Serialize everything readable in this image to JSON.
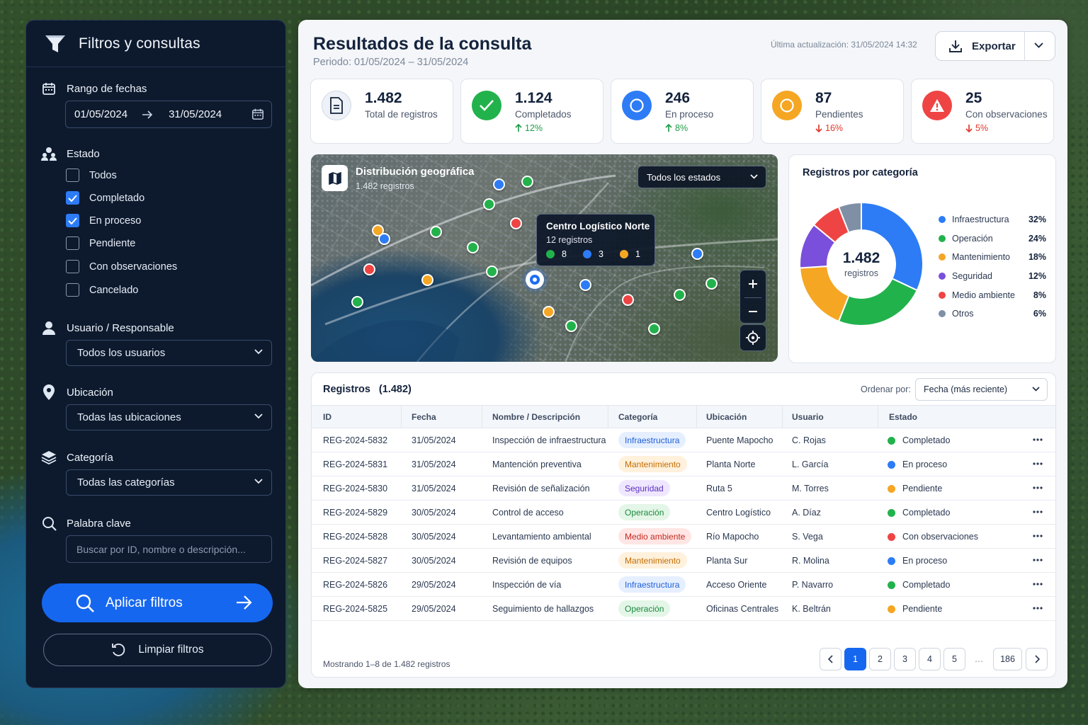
{
  "sidebar": {
    "title": "Filtros y consultas",
    "date_range": {
      "label": "Rango de fechas",
      "from": "01/05/2024",
      "to": "31/05/2024"
    },
    "status": {
      "label": "Estado",
      "options": [
        {
          "label": "Todos",
          "checked": false
        },
        {
          "label": "Completado",
          "checked": true
        },
        {
          "label": "En proceso",
          "checked": true
        },
        {
          "label": "Pendiente",
          "checked": false
        },
        {
          "label": "Con observaciones",
          "checked": false
        },
        {
          "label": "Cancelado",
          "checked": false
        }
      ]
    },
    "user": {
      "label": "Usuario / Responsable",
      "value": "Todos los usuarios"
    },
    "location": {
      "label": "Ubicación",
      "value": "Todas las ubicaciones"
    },
    "category": {
      "label": "Categoría",
      "value": "Todas las categorías"
    },
    "keyword": {
      "label": "Palabra clave",
      "placeholder": "Buscar por ID, nombre o descripción..."
    },
    "apply_label": "Aplicar filtros",
    "clear_label": "Limpiar filtros"
  },
  "header": {
    "title": "Resultados de la consulta",
    "period": "Periodo: 01/05/2024 – 31/05/2024",
    "updated": "Última actualización: 31/05/2024 14:32",
    "export_label": "Exportar"
  },
  "kpis": [
    {
      "value": "1.482",
      "label": "Total de registros",
      "delta": "",
      "dir": "",
      "icon": "document-icon"
    },
    {
      "value": "1.124",
      "label": "Completados",
      "delta": "12%",
      "dir": "up",
      "icon": "check-icon"
    },
    {
      "value": "246",
      "label": "En proceso",
      "delta": "8%",
      "dir": "up",
      "icon": "circle-icon"
    },
    {
      "value": "87",
      "label": "Pendientes",
      "delta": "16%",
      "dir": "down",
      "icon": "circle-icon"
    },
    {
      "value": "25",
      "label": "Con observaciones",
      "delta": "5%",
      "dir": "down",
      "icon": "warning-icon"
    }
  ],
  "map": {
    "title": "Distribución geográfica",
    "subtitle": "1.482 registros",
    "filter": "Todos los estados",
    "tooltip": {
      "title": "Centro Logístico Norte",
      "subtitle": "12 registros",
      "counts": [
        {
          "color": "#22b24c",
          "value": "8"
        },
        {
          "color": "#2d7cf6",
          "value": "3"
        },
        {
          "color": "#f5a623",
          "value": "1"
        }
      ]
    }
  },
  "colors": {
    "blue": "#2d7cf6",
    "green": "#22b24c",
    "orange": "#f5a623",
    "purple": "#7a4fdc",
    "red": "#ef4444",
    "gray": "#7f8fa6",
    "primary": "#1667f0"
  },
  "categories_card": {
    "title": "Registros por categoría",
    "center_value": "1.482",
    "center_label": "registros"
  },
  "chart_data": {
    "type": "pie",
    "title": "Registros por categoría",
    "categories": [
      "Infraestructura",
      "Operación",
      "Mantenimiento",
      "Seguridad",
      "Medio ambiente",
      "Otros"
    ],
    "values": [
      32,
      24,
      18,
      12,
      8,
      6
    ],
    "labels": [
      "32%",
      "24%",
      "18%",
      "12%",
      "8%",
      "6%"
    ],
    "colors": [
      "#2d7cf6",
      "#22b24c",
      "#f5a623",
      "#7a4fdc",
      "#ef4444",
      "#7f8fa6"
    ],
    "legend": "right"
  },
  "table": {
    "title": "Registros",
    "count": "(1.482)",
    "sort_label": "Ordenar por:",
    "sort_value": "Fecha (más reciente)",
    "columns": [
      "ID",
      "Fecha",
      "Nombre / Descripción",
      "Categoría",
      "Ubicación",
      "Usuario",
      "Estado"
    ],
    "rows": [
      {
        "id": "REG-2024-5832",
        "date": "31/05/2024",
        "name": "Inspección de infraestructura",
        "cat": "Infraestructura",
        "loc": "Puente Mapocho",
        "user": "C. Rojas",
        "status": "Completado"
      },
      {
        "id": "REG-2024-5831",
        "date": "31/05/2024",
        "name": "Mantención preventiva",
        "cat": "Mantenimiento",
        "loc": "Planta Norte",
        "user": "L. García",
        "status": "En proceso"
      },
      {
        "id": "REG-2024-5830",
        "date": "31/05/2024",
        "name": "Revisión de señalización",
        "cat": "Seguridad",
        "loc": "Ruta 5",
        "user": "M. Torres",
        "status": "Pendiente"
      },
      {
        "id": "REG-2024-5829",
        "date": "30/05/2024",
        "name": "Control de acceso",
        "cat": "Operación",
        "loc": "Centro Logístico",
        "user": "A. Díaz",
        "status": "Completado"
      },
      {
        "id": "REG-2024-5828",
        "date": "30/05/2024",
        "name": "Levantamiento ambiental",
        "cat": "Medio ambiente",
        "loc": "Río Mapocho",
        "user": "S. Vega",
        "status": "Con observaciones"
      },
      {
        "id": "REG-2024-5827",
        "date": "30/05/2024",
        "name": "Revisión de equipos",
        "cat": "Mantenimiento",
        "loc": "Planta Sur",
        "user": "R. Molina",
        "status": "En proceso"
      },
      {
        "id": "REG-2024-5826",
        "date": "29/05/2024",
        "name": "Inspección de vía",
        "cat": "Infraestructura",
        "loc": "Acceso Oriente",
        "user": "P. Navarro",
        "status": "Completado"
      },
      {
        "id": "REG-2024-5825",
        "date": "29/05/2024",
        "name": "Seguimiento de hallazgos",
        "cat": "Operación",
        "loc": "Oficinas Centrales",
        "user": "K. Beltrán",
        "status": "Pendiente"
      }
    ],
    "footer": "Mostrando 1–8 de 1.482 registros",
    "pages": [
      "1",
      "2",
      "3",
      "4",
      "5",
      "…",
      "186"
    ]
  }
}
